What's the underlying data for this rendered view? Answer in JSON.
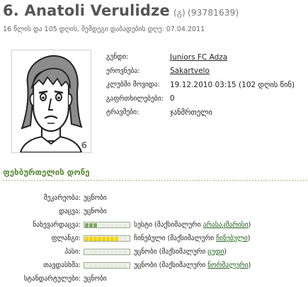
{
  "player": {
    "name": "6. Anatoli Verulidze",
    "specialty": "(გ)",
    "id": "(93781639)",
    "age_line": "16 წლის და 105 დღის, შემდეგი დაბადების დღე: 07.04.2011",
    "shirt_number": "6"
  },
  "info": {
    "rows": [
      {
        "label": "გუნდი:",
        "value": "Juniors FC Adza",
        "link": true
      },
      {
        "label": "ეროვნება:",
        "value": "Sakartvelo",
        "link": true
      },
      {
        "label": "კლუბში მოვიდა:",
        "value": "19.12.2010 03:15 (102 დღის წინ)",
        "link": false
      },
      {
        "label": "გაფრთხილებები:",
        "value": "0",
        "link": false
      },
      {
        "label": "ტრავმები:",
        "value": "ჯანმრთელი",
        "link": false
      }
    ]
  },
  "skills_section": {
    "title": "ფეხბურთელის დონე"
  },
  "skills": [
    {
      "label": "მეკარეობა:",
      "has_bar": false,
      "text": "უცნობი"
    },
    {
      "label": "დაცვა:",
      "has_bar": false,
      "text": "უცნობი"
    },
    {
      "label": "ნახევარდაცვა:",
      "has_bar": true,
      "level_fraction": 0.3,
      "color": "#7fa86a",
      "text_before": "სუსტი (მაქსიმალური ",
      "link": "არასაკმარისი",
      "text_after": ")"
    },
    {
      "label": "ფლანგი:",
      "has_bar": true,
      "level_fraction": 0.8,
      "color": "#f2d400",
      "text_before": "ჩინებული (მაქსიმალური ",
      "link": "ჩინებული",
      "text_after": ")"
    },
    {
      "label": "პასი:",
      "has_bar": true,
      "level_fraction": 0.0,
      "color": "#7fa86a",
      "text_before": "უცნობი (მაქსიმალური ",
      "link": "ცუდი",
      "text_after": ")"
    },
    {
      "label": "თავდასხმა:",
      "has_bar": true,
      "level_fraction": 0.0,
      "color": "#7fa86a",
      "text_before": "უცნობი (მაქსიმალური ",
      "link": "ნორმალური",
      "text_after": ")"
    },
    {
      "label": "სტანდარტულები:",
      "has_bar": false,
      "text": "უცნობი"
    }
  ],
  "colors": {
    "accent_green": "#5a8a3a",
    "link": "#1d5e17",
    "bar_yellow": "#f2d400",
    "bar_green": "#7fa86a"
  },
  "icons": {
    "avatar": "player-face-avatar"
  }
}
